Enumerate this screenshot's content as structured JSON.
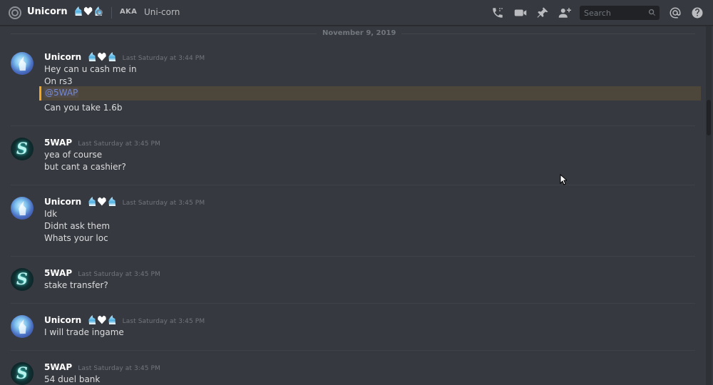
{
  "header": {
    "title": "Unicorn",
    "aka_badge": "AKA",
    "aka_name": "Uni-corn",
    "search_placeholder": "Search",
    "icons": [
      "at-icon",
      "call-icon",
      "video-icon",
      "pin-icon",
      "add-friend-icon",
      "search-icon",
      "mentions-icon",
      "help-icon"
    ]
  },
  "date_divider": "November 9, 2019",
  "messages": [
    {
      "author": "Unicorn",
      "timestamp": "Last Saturday at 3:44 PM",
      "lines": [
        "Hey can u cash me in",
        "On rs3"
      ],
      "mention": "@5WAP",
      "after_mention": "Can you take 1.6b"
    },
    {
      "author": "5WAP",
      "timestamp": "Last Saturday at 3:45 PM",
      "lines": [
        "yea of course",
        "but cant a cashier?"
      ]
    },
    {
      "author": "Unicorn",
      "timestamp": "Last Saturday at 3:45 PM",
      "lines": [
        "Idk",
        "Didnt ask them",
        "Whats your loc"
      ]
    },
    {
      "author": "5WAP",
      "timestamp": "Last Saturday at 3:45 PM",
      "lines": [
        "stake transfer?"
      ]
    },
    {
      "author": "Unicorn",
      "timestamp": "Last Saturday at 3:45 PM",
      "lines": [
        "I will trade ingame"
      ]
    },
    {
      "author": "5WAP",
      "timestamp": "Last Saturday at 3:45 PM",
      "lines": [
        "54 duel bank"
      ]
    }
  ],
  "colors": {
    "background": "#36393f",
    "mention_highlight": "#faa61a",
    "mention_text": "#7289da"
  }
}
